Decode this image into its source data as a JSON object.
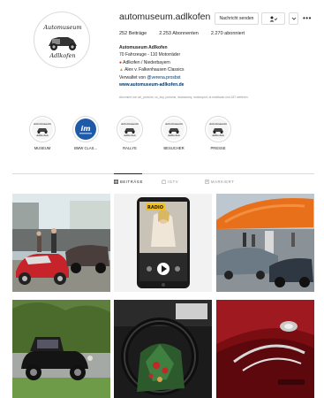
{
  "profile": {
    "username": "automuseum.adlkofen",
    "avatar_text_top": "Automuseum",
    "avatar_text_bottom": "Adlkofen",
    "message_label": "Nachricht senden",
    "follow_icon": "person-check-icon",
    "dropdown_icon": "chevron-down-icon",
    "more_label": "•••"
  },
  "stats": {
    "posts": "252 Beiträge",
    "followers": "2.253 Abonnenten",
    "following": "2.270 abonniert"
  },
  "bio": {
    "name": "Automuseum Adlkofen",
    "line1": "70 Fahrzeuge - 110 Motorräder",
    "line2": "Adlkofen / Niederbayern",
    "line3": "Alex v. Falkenhausen Classics",
    "managed_prefix": "Verwaltet von ",
    "managed_handle": "@verena.prosbst",
    "link": "www.automuseum-adlkofen.de"
  },
  "followed_by": "Abonniert von art_porsche, cs_buy, porsche, dramaoshy, motorsport, la.mobilauto und 187 weiteren",
  "highlights": [
    {
      "label": "MUSEUM",
      "icon": "museum-logo"
    },
    {
      "label": "BMW CLAS...",
      "icon": "im-logo"
    },
    {
      "label": "RALLYE",
      "icon": "museum-logo"
    },
    {
      "label": "BESUCHER",
      "icon": "museum-logo"
    },
    {
      "label": "PRESSE",
      "icon": "museum-logo"
    }
  ],
  "tabs": [
    {
      "label": "BEITRÄGE",
      "icon": "grid-icon",
      "active": true
    },
    {
      "label": "IGTV",
      "icon": "igtv-icon",
      "active": false
    },
    {
      "label": "MARKIERT",
      "icon": "tagged-icon",
      "active": false
    }
  ],
  "posts": [
    {
      "subject": "red-classic-cars-at-event"
    },
    {
      "subject": "radio-app-phone-screen",
      "badge": "RADIO"
    },
    {
      "subject": "orange-tent-car-meet"
    },
    {
      "subject": "black-vintage-car"
    },
    {
      "subject": "christmas-steering-wheel"
    },
    {
      "subject": "red-car-detail"
    }
  ],
  "colors": {
    "border": "#dbdbdb",
    "link": "#00376b",
    "muted": "#8e8e8e",
    "text": "#262626"
  }
}
